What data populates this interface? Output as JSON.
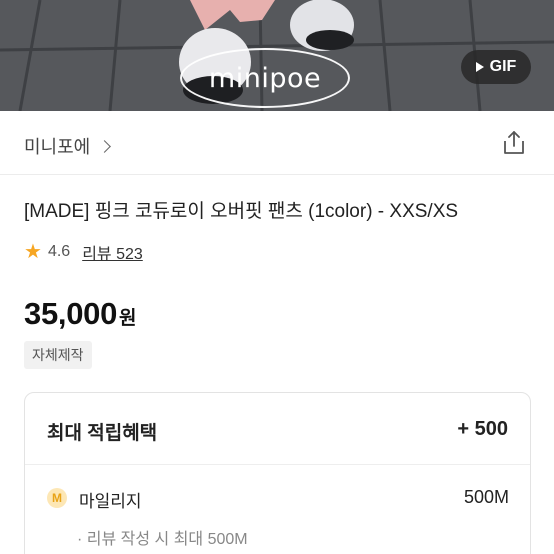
{
  "hero": {
    "watermark": "minipoe",
    "gif_badge": "GIF"
  },
  "shop": {
    "name": "미니포에",
    "share_icon": "share-icon"
  },
  "product": {
    "title": "[MADE] 핑크 코듀로이 오버핏 팬츠 (1color) - XXS/XS",
    "rating": "4.6",
    "review_link": "리뷰 523",
    "price": "35,000",
    "price_unit": "원",
    "tag": "자체제작"
  },
  "benefit": {
    "label": "최대 적립혜택",
    "value": "+ 500",
    "mileage_icon": "M",
    "mileage_label": "마일리지",
    "mileage_value": "500M",
    "note": "· 리뷰 작성 시 최대 500M"
  },
  "colors": {
    "star": "#f6a623",
    "mileage_badge_bg": "#fde7b5",
    "mileage_badge_fg": "#e8a317"
  }
}
